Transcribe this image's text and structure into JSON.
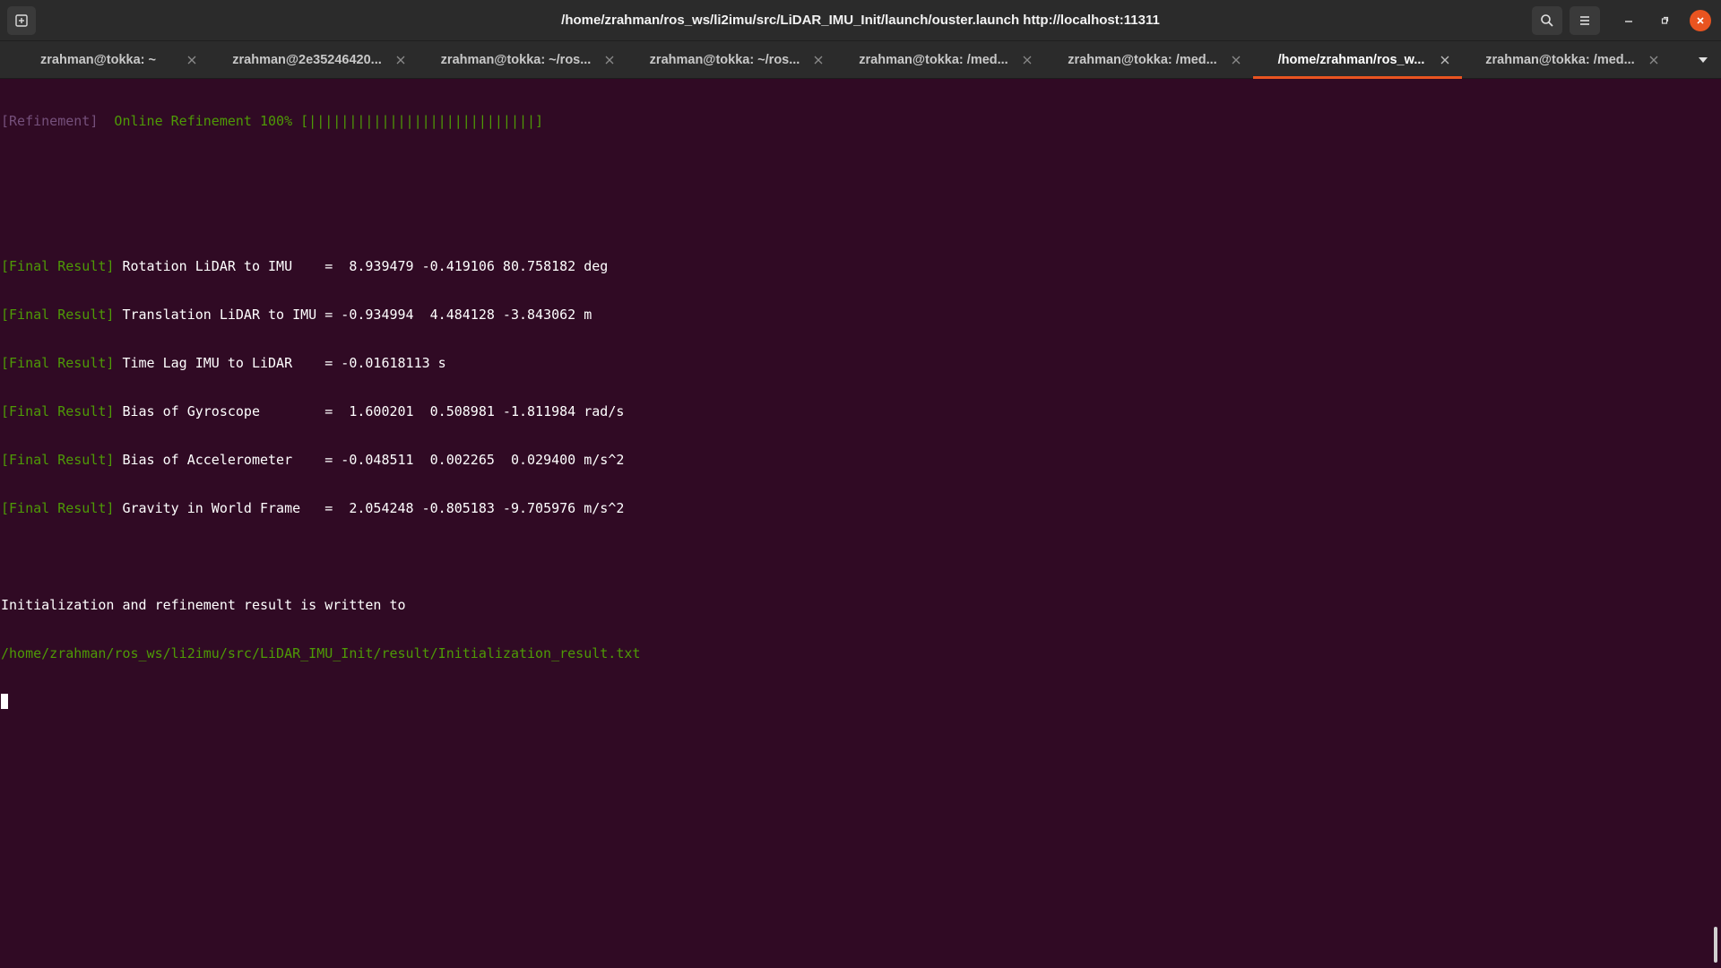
{
  "window": {
    "title": "/home/zrahman/ros_ws/li2imu/src/LiDAR_IMU_Init/launch/ouster.launch http://localhost:11311"
  },
  "headerbar": {
    "new_tab_icon": "new-tab-icon",
    "search_icon": "search-icon",
    "menu_icon": "hamburger-menu-icon",
    "minimize_icon": "minimize-icon",
    "maximize_icon": "maximize-icon",
    "close_icon": "close-icon",
    "close_color": "#e95420"
  },
  "tabs": [
    {
      "label": "zrahman@tokka: ~",
      "active": false
    },
    {
      "label": "zrahman@2e35246420...",
      "active": false
    },
    {
      "label": "zrahman@tokka: ~/ros...",
      "active": false
    },
    {
      "label": "zrahman@tokka: ~/ros...",
      "active": false
    },
    {
      "label": "zrahman@tokka: /med...",
      "active": false
    },
    {
      "label": "zrahman@tokka: /med...",
      "active": false
    },
    {
      "label": "/home/zrahman/ros_w...",
      "active": true
    },
    {
      "label": "zrahman@tokka: /med...",
      "active": false
    }
  ],
  "colors": {
    "terminal_bg": "#300a24",
    "accent": "#e95420",
    "green": "#4e9a06",
    "purple": "#75507b"
  },
  "terminal": {
    "refinement_tag": "[Refinement]",
    "refinement_text": "  Online Refinement 100% [||||||||||||||||||||||||||||]",
    "final_results": [
      {
        "tag": "[Final Result]",
        "text": " Rotation LiDAR to IMU    =  8.939479 -0.419106 80.758182 deg"
      },
      {
        "tag": "[Final Result]",
        "text": " Translation LiDAR to IMU = -0.934994  4.484128 -3.843062 m"
      },
      {
        "tag": "[Final Result]",
        "text": " Time Lag IMU to LiDAR    = -0.01618113 s"
      },
      {
        "tag": "[Final Result]",
        "text": " Bias of Gyroscope        =  1.600201  0.508981 -1.811984 rad/s"
      },
      {
        "tag": "[Final Result]",
        "text": " Bias of Accelerometer    = -0.048511  0.002265  0.029400 m/s^2"
      },
      {
        "tag": "[Final Result]",
        "text": " Gravity in World Frame   =  2.054248 -0.805183 -9.705976 m/s^2"
      }
    ],
    "written_msg": "Initialization and refinement result is written to",
    "result_path": "/home/zrahman/ros_ws/li2imu/src/LiDAR_IMU_Init/result/Initialization_result.txt"
  }
}
